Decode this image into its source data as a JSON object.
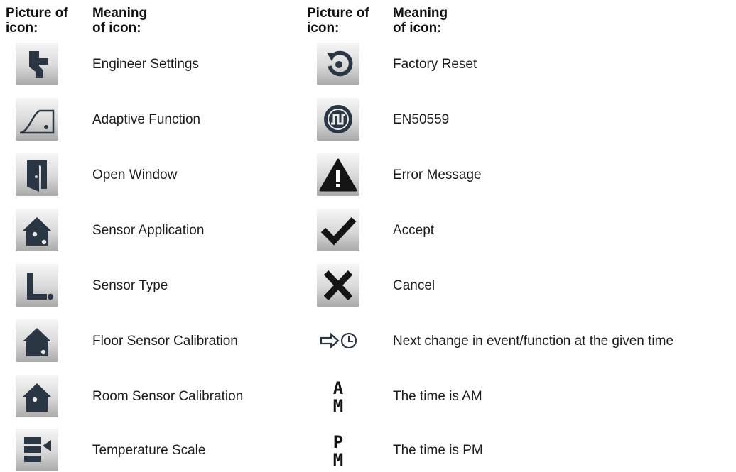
{
  "columns": [
    {
      "picture_header": [
        "Picture of",
        "icon:"
      ],
      "meaning_header": [
        "Meaning",
        "of icon:"
      ]
    },
    {
      "picture_header": [
        "Picture of",
        "icon:"
      ],
      "meaning_header": [
        "Meaning",
        "of icon:"
      ]
    }
  ],
  "left_items": [
    {
      "icon": "wrench-icon",
      "meaning": "Engineer Settings"
    },
    {
      "icon": "adaptive-curve-icon",
      "meaning": "Adaptive Function"
    },
    {
      "icon": "open-door-icon",
      "meaning": "Open Window"
    },
    {
      "icon": "house-sensor-dots-icon",
      "meaning": "Sensor Application"
    },
    {
      "icon": "sensor-type-icon",
      "meaning": "Sensor Type"
    },
    {
      "icon": "house-floor-icon",
      "meaning": "Floor Sensor Calibration"
    },
    {
      "icon": "house-room-icon",
      "meaning": "Room Sensor Calibration"
    },
    {
      "icon": "temperature-scale-icon",
      "meaning": "Temperature Scale"
    }
  ],
  "right_items": [
    {
      "icon": "factory-reset-icon",
      "meaning": "Factory Reset"
    },
    {
      "icon": "en50559-icon",
      "meaning": "EN50559"
    },
    {
      "icon": "warning-triangle-icon",
      "meaning": "Error Message"
    },
    {
      "icon": "checkmark-icon",
      "meaning": "Accept"
    },
    {
      "icon": "cross-icon",
      "meaning": "Cancel"
    },
    {
      "icon": "arrow-clock-icon",
      "meaning": "Next change in event/function at the given time"
    },
    {
      "icon": "am-icon",
      "meaning": "The time is AM",
      "glyphs": [
        "A",
        "M"
      ]
    },
    {
      "icon": "pm-icon",
      "meaning": "The time is PM",
      "glyphs": [
        "P",
        "M"
      ]
    }
  ],
  "colors": {
    "icon_dark": "#2b3644",
    "text": "#1c1c1c"
  }
}
